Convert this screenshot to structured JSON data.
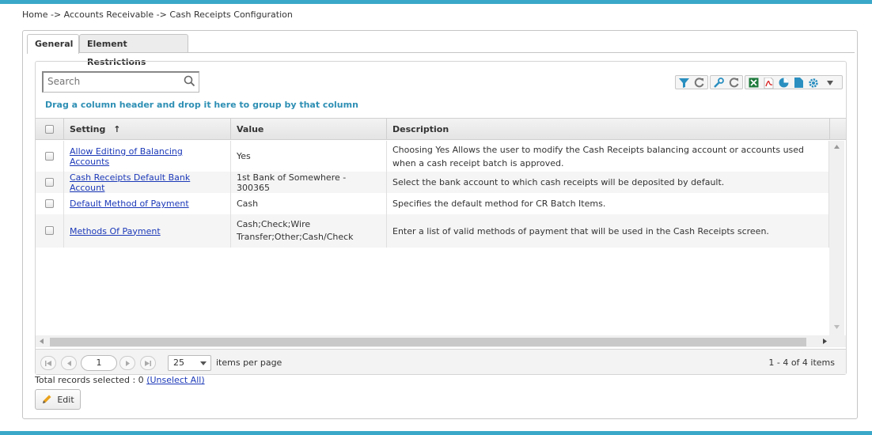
{
  "breadcrumb": "Home -> Accounts Receivable -> Cash Receipts Configuration",
  "tabs": [
    {
      "label": "General",
      "active": true
    },
    {
      "label": "Element Restrictions",
      "active": false
    }
  ],
  "search": {
    "placeholder": "Search"
  },
  "group_hint": "Drag a column header and drop it here to group by that column",
  "toolbar_icons": [
    "filter-icon",
    "refresh-filter-icon",
    "wrench-icon",
    "refresh-icon",
    "excel-icon",
    "pdf-icon",
    "chart-icon",
    "document-icon",
    "gear-icon",
    "dropdown-arrow-icon"
  ],
  "grid": {
    "columns": {
      "setting": "Setting",
      "sort_indicator": "↑",
      "value": "Value",
      "description": "Description"
    },
    "rows": [
      {
        "setting": "Allow Editing of Balancing Accounts",
        "value": "Yes",
        "description": "Choosing Yes Allows the user to modify the Cash Receipts balancing account or accounts used when a cash receipt batch is approved."
      },
      {
        "setting": "Cash Receipts Default Bank Account",
        "value": "1st Bank of Somewhere - 300365",
        "description": "Select the bank account to which cash receipts will be deposited by default."
      },
      {
        "setting": "Default Method of Payment",
        "value": "Cash",
        "description": "Specifies the default method for CR Batch Items."
      },
      {
        "setting": "Methods Of Payment",
        "value": "Cash;Check;Wire Transfer;Other;Cash/Check",
        "description": "Enter a list of valid methods of payment that will be used in the Cash Receipts screen."
      }
    ]
  },
  "pager": {
    "page": "1",
    "page_size": "25",
    "items_per_page_label": "items per page",
    "summary": "1 - 4 of 4 items"
  },
  "records": {
    "text": "Total records selected : 0",
    "unselect_label": "(Unselect All)"
  },
  "edit_button": {
    "label": "Edit"
  },
  "colors": {
    "accent": "#3aa8c8",
    "link": "#1c39b8",
    "hint": "#2e8fb4"
  }
}
